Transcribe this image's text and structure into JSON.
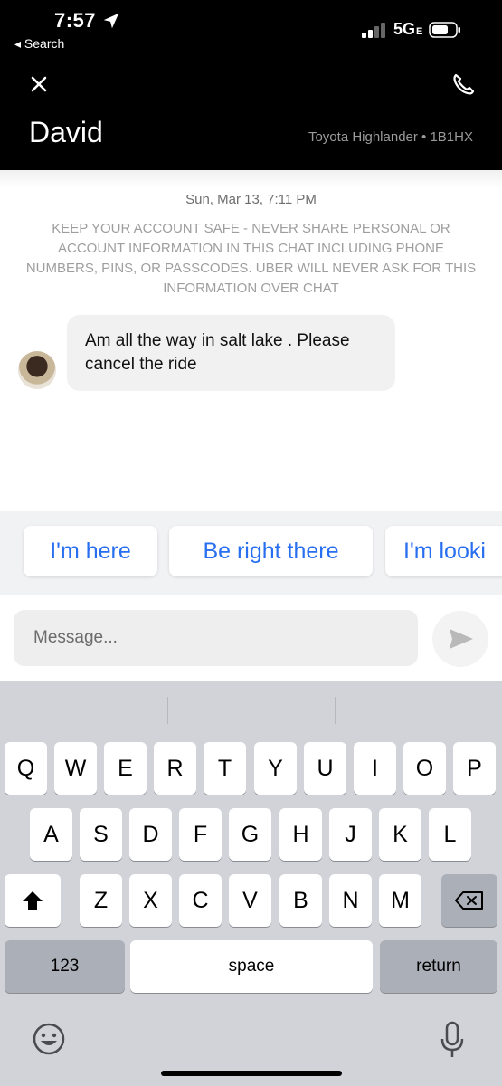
{
  "status_bar": {
    "time": "7:57",
    "back_label": "◂ Search",
    "network": "5G",
    "network_suffix": "E"
  },
  "header": {
    "driver_name": "David",
    "vehicle": "Toyota Highlander • 1B1HX"
  },
  "chat": {
    "date": "Sun, Mar 13, 7:11 PM",
    "safety_notice": "KEEP YOUR ACCOUNT SAFE - NEVER SHARE PERSONAL OR ACCOUNT INFORMATION IN THIS CHAT INCLUDING PHONE NUMBERS, PINS, OR PASSCODES. UBER WILL NEVER ASK FOR THIS INFORMATION OVER CHAT",
    "messages": [
      {
        "sender": "driver",
        "text": "Am all the way in salt lake . Please cancel the ride"
      }
    ]
  },
  "quick_replies": [
    "I'm here",
    "Be right there",
    "I'm looki"
  ],
  "compose": {
    "placeholder": "Message...",
    "value": ""
  },
  "keyboard": {
    "row1": [
      "Q",
      "W",
      "E",
      "R",
      "T",
      "Y",
      "U",
      "I",
      "O",
      "P"
    ],
    "row2": [
      "A",
      "S",
      "D",
      "F",
      "G",
      "H",
      "J",
      "K",
      "L"
    ],
    "row3": [
      "Z",
      "X",
      "C",
      "V",
      "B",
      "N",
      "M"
    ],
    "numbers_label": "123",
    "space_label": "space",
    "return_label": "return"
  },
  "colors": {
    "header_bg": "#000000",
    "accent_blue": "#276ef1",
    "keyboard_bg": "#d1d3d9"
  },
  "icons": {
    "close": "close-icon",
    "phone": "phone-icon",
    "send": "send-icon",
    "shift": "shift-icon",
    "delete": "backspace-icon",
    "emoji": "emoji-icon",
    "mic": "microphone-icon"
  }
}
